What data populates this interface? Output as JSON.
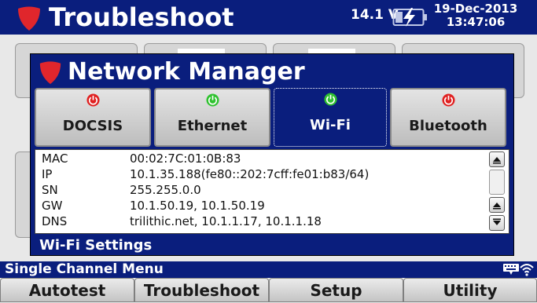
{
  "header": {
    "title": "Troubleshoot",
    "voltage": "14.1 V",
    "date": "19-Dec-2013",
    "time": "13:47:06"
  },
  "dialog": {
    "title": "Network Manager",
    "tabs": [
      {
        "label": "DOCSIS",
        "status": "off",
        "active": false
      },
      {
        "label": "Ethernet",
        "status": "on",
        "active": false
      },
      {
        "label": "Wi-Fi",
        "status": "on",
        "active": true
      },
      {
        "label": "Bluetooth",
        "status": "off",
        "active": false
      }
    ],
    "info": [
      {
        "key": "MAC",
        "value": "00:02:7C:01:0B:83"
      },
      {
        "key": "IP",
        "value": "10.1.35.188(fe80::202:7cff:fe01:b83/64)"
      },
      {
        "key": "SN",
        "value": "255.255.0.0"
      },
      {
        "key": "GW",
        "value": "10.1.50.19, 10.1.50.19"
      },
      {
        "key": "DNS",
        "value": "trilithic.net, 10.1.1.17, 10.1.1.18"
      }
    ],
    "footer_label": "Wi-Fi Settings"
  },
  "status_bar": {
    "label": "Single Channel Menu"
  },
  "bottom_menu": [
    "Autotest",
    "Troubleshoot",
    "Setup",
    "Utility"
  ],
  "colors": {
    "brand_blue": "#0a1e7d",
    "power_on": "#2fc22f",
    "power_off": "#e02020",
    "logo_red": "#e0262c"
  },
  "icons": [
    "logo-shield-icon",
    "battery-charging-icon",
    "power-icon",
    "scroll-up-icon",
    "scroll-down-icon",
    "keyboard-icon",
    "wifi-icon"
  ]
}
